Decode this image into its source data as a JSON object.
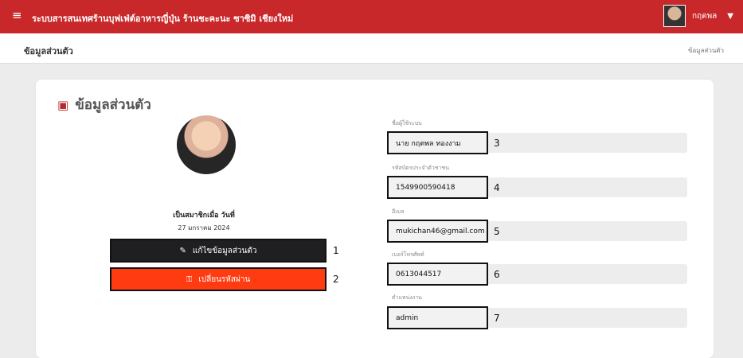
{
  "topbar": {
    "menu_icon": "hamburger-icon",
    "title": "ระบบสารสนเทศร้านบุฟเฟ่ต์อาหารญี่ปุ่น ร้านชะคะนะ ซาซิมิ เชียงใหม่",
    "user": {
      "name": "กฤตพล",
      "avatar_icon": "user-avatar-icon",
      "dropdown_icon": "caret-down-icon"
    }
  },
  "subheader": {
    "page_name": "ข้อมูลส่วนตัว",
    "breadcrumb": "ข้อมูลส่วนตัว"
  },
  "card": {
    "title": "ข้อมูลส่วนตัว",
    "title_icon": "id-card-icon",
    "profile": {
      "member_label": "เป็นสมาชิกเมื่อ วันที่",
      "member_date": "27 มกราคม 2024"
    },
    "buttons": [
      {
        "label": "แก้ไขข้อมูลส่วนตัว",
        "icon": "pencil-icon",
        "marker": "1"
      },
      {
        "label": "เปลี่ยนรหัสผ่าน",
        "icon": "key-icon",
        "marker": "2"
      }
    ],
    "fields": [
      {
        "label": "ชื่อผู้ใช้ระบบ",
        "value": "นาย กฤตพล ทองงาม",
        "marker": "3"
      },
      {
        "label": "รหัสบัตรประจำตัวชาชน",
        "value": "1549900590418",
        "marker": "4"
      },
      {
        "label": "อีเมล",
        "value": "mukichan46@gmail.com",
        "marker": "5"
      },
      {
        "label": "เบอร์โทรศัพท์",
        "value": "0613044517",
        "marker": "6"
      },
      {
        "label": "ตำแหน่งงาน",
        "value": "admin",
        "marker": "7"
      }
    ]
  },
  "colors": {
    "brand": "#c9282b",
    "accent_button": "#ff3b12",
    "dark_button": "#1f1f22"
  }
}
